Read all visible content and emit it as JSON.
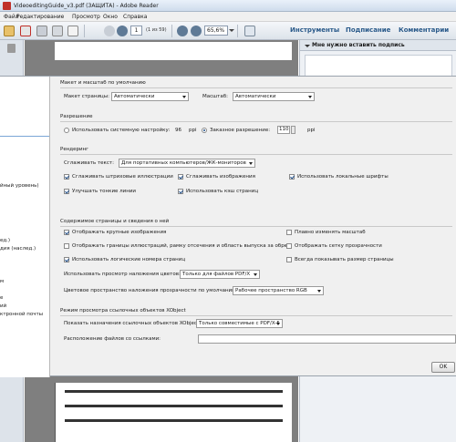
{
  "window": {
    "title": "VideoeditingGuide_v3.pdf (ЗАЩИТА) - Adobe Reader"
  },
  "menu": {
    "items": [
      "Файл",
      "Редактирование",
      "Просмотр",
      "Окно",
      "Справка"
    ]
  },
  "toolbar": {
    "page_number": "1",
    "page_of": "(1 из 59)",
    "zoom": "65,6%",
    "tools_label": "Инструменты",
    "sign_label": "Подписание",
    "comments_label": "Комментарии"
  },
  "right_pane": {
    "header": "Мне нужно вставить подпись"
  },
  "categories": {
    "items": [
      "йный уровень)",
      "ед.)",
      "дия (наслед.)",
      "м",
      "е",
      "ий",
      "ктронной почты"
    ]
  },
  "prefs": {
    "layout_section": "Макет и масштаб по умолчанию",
    "page_layout_label": "Макет страницы:",
    "page_layout_value": "Автоматически",
    "zoom_label": "Масштаб:",
    "zoom_value": "Автоматически",
    "resolution_section": "Разрешение",
    "system_setting_label": "Использовать системную настройку:",
    "system_dpi": "96",
    "ppi": "ppi",
    "custom_resolution_label": "Заказное разрешение:",
    "custom_dpi": "110",
    "custom_ppi": "ppi",
    "rendering_section": "Рендеринг",
    "smooth_text_label": "Сглаживать текст:",
    "smooth_text_value": "Для портативных компьютеров/ЖК-мониторов",
    "smooth_line_art": "Сглаживать штриховые иллюстрации",
    "smooth_images": "Сглаживать изображения",
    "use_local_fonts": "Использовать локальные шрифты",
    "enhance_thin_lines": "Улучшать тонкие линии",
    "use_page_cache": "Использовать кэш страниц",
    "content_section": "Содержимое страницы и сведения о ней",
    "show_large_images": "Отображать крупные изображения",
    "smooth_zoom": "Плавно изменять масштаб",
    "show_art_trim_bleed": "Отображать границы иллюстраций, рамку отсечения и область выпуска за обрез",
    "show_transparency_grid": "Отображать сетку прозрачности",
    "use_logical_page_numbers": "Использовать логические номера страниц",
    "always_show_doc_page_size": "Всегда показывать размер страницы",
    "overprint_preview_label": "Использовать просмотр наложения цветов:",
    "overprint_preview_value": "Только для файлов PDF/X",
    "blend_space_label": "Цветовое пространство наложения прозрачности по умолчанию:",
    "blend_space_value": "Рабочее пространство RGB",
    "xobject_section": "Режим просмотра ссылочных объектов XObject",
    "xobject_targets_label": "Показать назначения ссылочных объектов XObject:",
    "xobject_targets_value": "Только совместимые с PDF/X-5",
    "xobject_location_label": "Расположение файлов со ссылками:",
    "ok_label": "OK"
  },
  "colors": {
    "accent": "#2a5a8a",
    "doc_background": "#7f7f7f",
    "dialog_background": "#f0f0f0"
  },
  "icons": [
    "acrobat-icon",
    "open-icon",
    "create-icon",
    "save-icon",
    "print-icon",
    "email-icon",
    "prev-page-icon",
    "next-page-icon",
    "zoom-out-icon",
    "zoom-in-icon",
    "fit-icon",
    "lock-icon"
  ]
}
